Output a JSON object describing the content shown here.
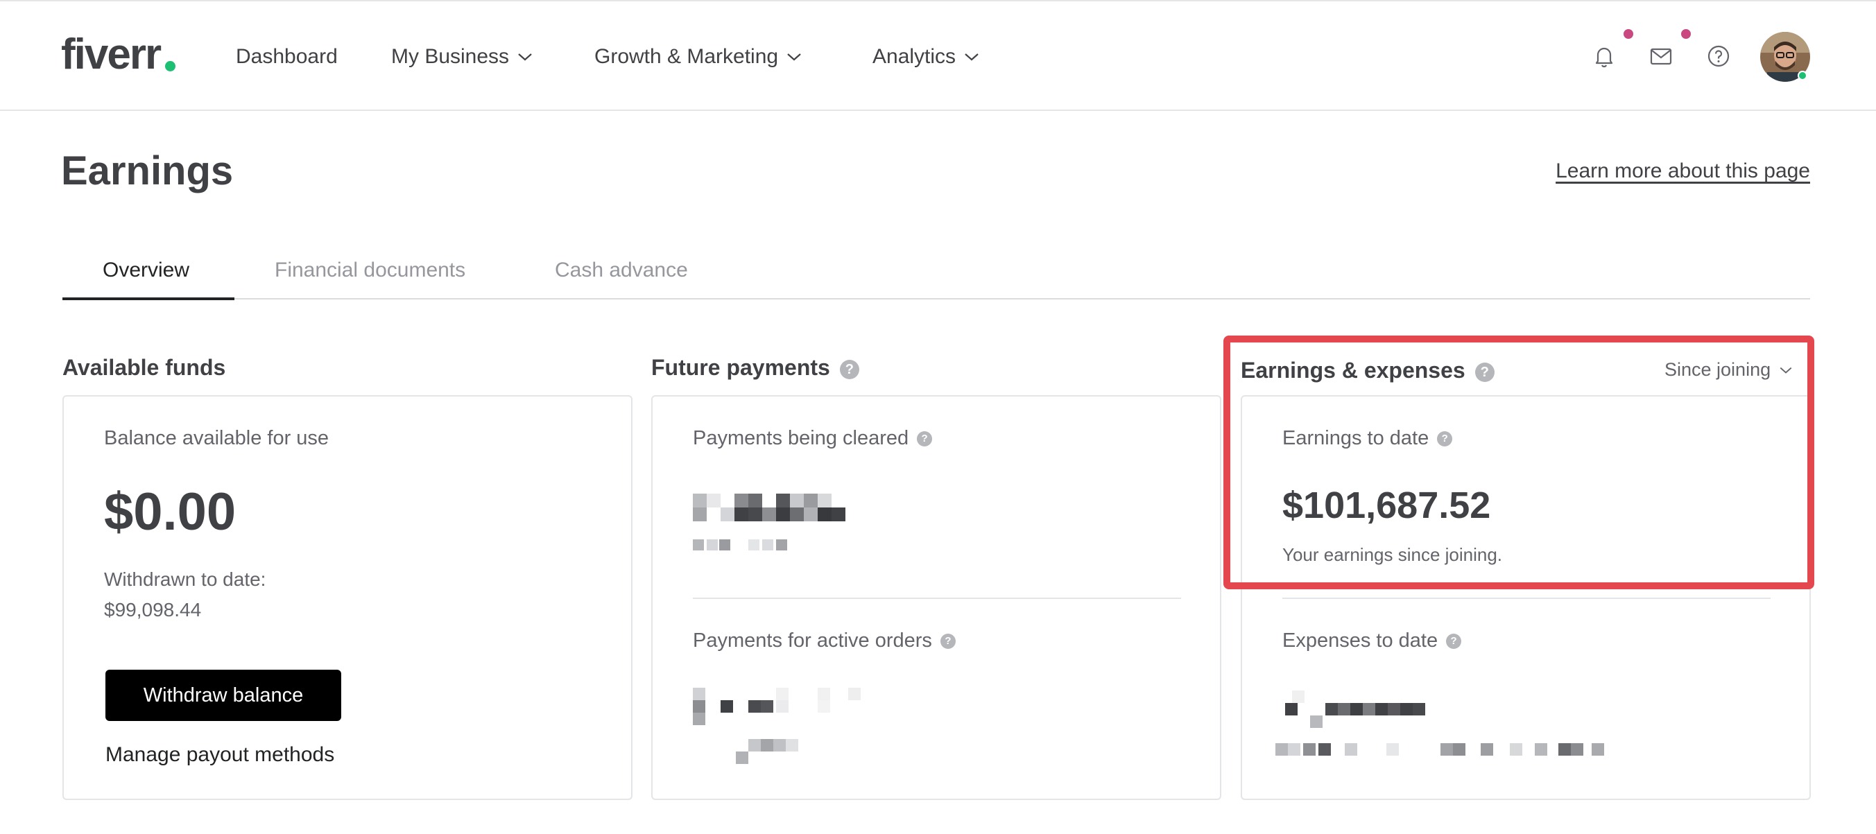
{
  "brand": {
    "logo_text": "fiverr",
    "accent_color": "#1dbf73"
  },
  "nav": {
    "items": [
      {
        "label": "Dashboard",
        "has_dropdown": false
      },
      {
        "label": "My Business",
        "has_dropdown": true
      },
      {
        "label": "Growth & Marketing",
        "has_dropdown": true
      },
      {
        "label": "Analytics",
        "has_dropdown": true
      }
    ],
    "icons": [
      "bell-icon",
      "envelope-icon",
      "help-circle-icon"
    ],
    "notification_dot_color": "#c9487f"
  },
  "page": {
    "title": "Earnings",
    "learn_more_link": "Learn more about this page"
  },
  "tabs": [
    {
      "label": "Overview",
      "active": true
    },
    {
      "label": "Financial documents",
      "active": false
    },
    {
      "label": "Cash advance",
      "active": false
    }
  ],
  "available_funds": {
    "section_title": "Available funds",
    "balance_label": "Balance available for use",
    "balance_value": "$0.00",
    "withdrawn_label": "Withdrawn to date:",
    "withdrawn_value": "$99,098.44",
    "withdraw_button": "Withdraw balance",
    "manage_link": "Manage payout methods"
  },
  "future_payments": {
    "section_title": "Future payments",
    "cleared_label": "Payments being cleared",
    "active_orders_label": "Payments for active orders",
    "values_redacted": true
  },
  "earnings_expenses": {
    "section_title": "Earnings & expenses",
    "period_select": "Since joining",
    "earnings_label": "Earnings to date",
    "earnings_value": "$101,687.52",
    "earnings_caption": "Your earnings since joining.",
    "expenses_label": "Expenses to date",
    "expenses_redacted": true,
    "highlight_color": "#e5474f"
  }
}
